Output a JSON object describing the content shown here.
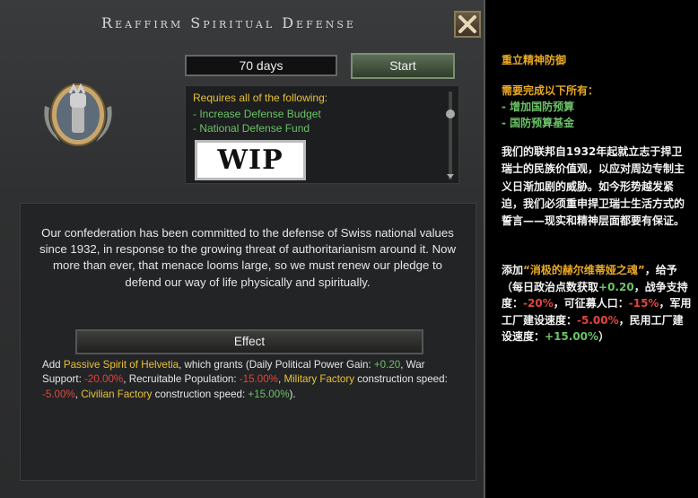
{
  "dialog": {
    "title": "Reaffirm Spiritual Defense",
    "days": "70 days",
    "start_label": "Start",
    "requirements_header": "Requires all of the following:",
    "requirements": [
      "- Increase Defense Budget",
      "- National Defense Fund"
    ],
    "wip_label": "WIP",
    "description": "Our confederation has been committed to the defense of Swiss national values since 1932, in response to the growing threat of authoritarianism around it. Now more than ever, that menace looms large, so we must renew our pledge to defend our way of life physically and spiritually.",
    "effect_header": "Effect",
    "effect": {
      "prefix": "Add ",
      "spirit": "Passive Spirit of Helvetia",
      "t1": ", which grants (Daily Political Power Gain: ",
      "pp": "+0.20",
      "t2": ", War Support: ",
      "ws": "-20.00%",
      "t3": ", Recruitable Population: ",
      "rp": "-15.00%",
      "t4": ", ",
      "mil": "Military Factory",
      "t5": " construction speed: ",
      "milv": "-5.00%",
      "t6": ", ",
      "civ": "Civilian Factory",
      "t7": " construction speed: ",
      "civv": "+15.00%",
      "t8": ")."
    },
    "icons": {
      "close": "close-icon",
      "emblem": "fist-emblem-icon"
    }
  },
  "tooltip": {
    "title": "重立精神防御",
    "req_header": "需要完成以下所有：",
    "req1": "- 增加国防预算",
    "req2": "- 国防预算基金",
    "desc": "我们的联邦自1932年起就立志于捍卫瑞士的民族价值观，以应对周边专制主义日渐加剧的威胁。如今形势越发紧迫，我们必须重申捍卫瑞士生活方式的誓言——现实和精神层面都要有保证。",
    "e_prefix": "添加",
    "e_spirit": "“消极的赫尔维蒂娅之魂”",
    "e_t1": "，给予（每日政治点数获取",
    "e_pp": "+0.20",
    "e_t2": "，战争支持度：",
    "e_ws": "-20%",
    "e_t3": "，可征募人口：",
    "e_rp": "-15%",
    "e_t4": "，军用工厂建设速度：",
    "e_mil": "-5.00%",
    "e_t5": "，民用工厂建设速度：",
    "e_civ": "+15.00%",
    "e_t6": "）"
  },
  "colors": {
    "accent_yellow": "#e8c13a",
    "positive_green": "#6bc267",
    "negative_red": "#e0463f"
  }
}
